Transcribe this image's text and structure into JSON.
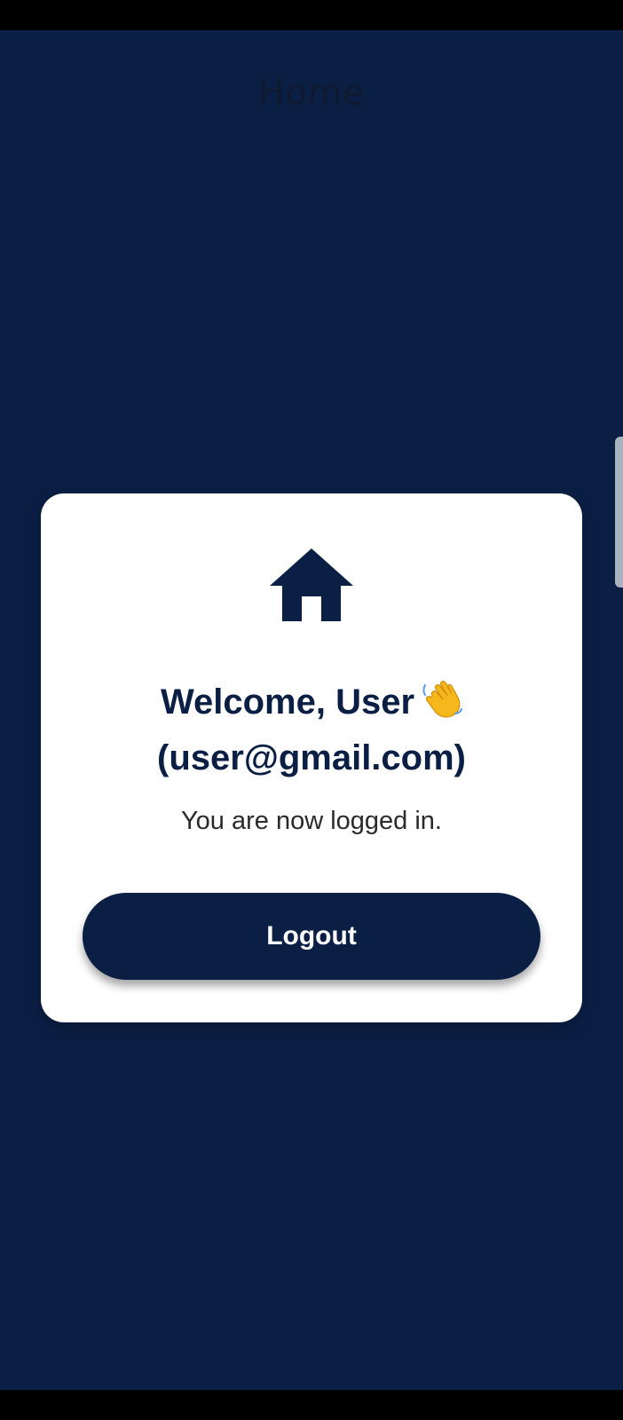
{
  "app_bar": {
    "title": "Home"
  },
  "card": {
    "icon": "home-icon",
    "welcome_text": "Welcome, User",
    "wave_icon": "waving-hand-icon",
    "email_text": "(user@gmail.com)",
    "status_text": "You are now logged in.",
    "logout_label": "Logout"
  },
  "colors": {
    "primary": "#0b1f45",
    "card_background": "#ffffff",
    "status_text": "#2a2a2a"
  }
}
